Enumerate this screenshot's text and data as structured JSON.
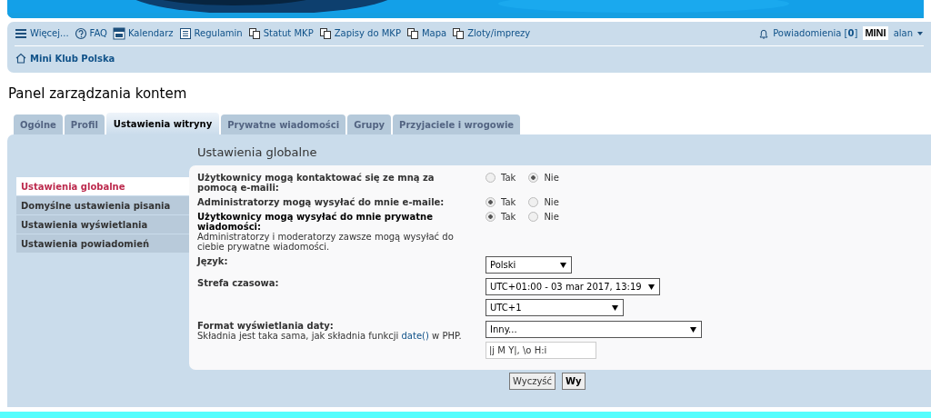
{
  "nav": {
    "items": [
      {
        "kind": "menu",
        "label": "Więcej..."
      },
      {
        "kind": "faq",
        "label": "FAQ"
      },
      {
        "kind": "calendar",
        "label": "Kalendarz"
      },
      {
        "kind": "rules",
        "label": "Regulamin"
      },
      {
        "kind": "page",
        "label": "Statut MKP"
      },
      {
        "kind": "page",
        "label": "Zapisy do MKP"
      },
      {
        "kind": "page",
        "label": "Mapa"
      },
      {
        "kind": "page",
        "label": "Zloty/imprezy"
      }
    ],
    "notifications": {
      "label": "Powiadomienia [**0**]"
    },
    "avatar_text": "MINI",
    "user": "alan",
    "breadcrumb": "Mini Klub Polska"
  },
  "page_title": "Panel zarządzania kontem",
  "tabs": [
    {
      "label": "Ogólne",
      "selected": false
    },
    {
      "label": "Profil",
      "selected": false
    },
    {
      "label": "Ustawienia witryny",
      "selected": true
    },
    {
      "label": "Prywatne wiadomości",
      "selected": false
    },
    {
      "label": "Grupy",
      "selected": false
    },
    {
      "label": "Przyjaciele i wrogowie",
      "selected": false
    }
  ],
  "sidebar": {
    "items": [
      {
        "label": "Ustawienia globalne",
        "selected": true
      },
      {
        "label": "Domyślne ustawienia pisania",
        "selected": false
      },
      {
        "label": "Ustawienia wyświetlania",
        "selected": false
      },
      {
        "label": "Ustawienia powiadomień",
        "selected": false
      }
    ]
  },
  "section_title": "Ustawienia globalne",
  "settings": [
    {
      "kind": "radio",
      "label": "Użytkownicy mogą kontaktować się ze mną za pomocą e-maili:",
      "options": [
        {
          "label": "Tak",
          "selected": false
        },
        {
          "label": "Nie",
          "selected": true
        }
      ]
    },
    {
      "kind": "radio",
      "label": "Administratorzy mogą wysyłać do mnie e-maile:",
      "options": [
        {
          "label": "Tak",
          "selected": true
        },
        {
          "label": "Nie",
          "selected": false
        }
      ]
    },
    {
      "kind": "radio",
      "label": "Użytkownicy mogą wysyłać do mnie prywatne wiadomości:",
      "hint": "Administratorzy i moderatorzy zawsze mogą wysyłać do ciebie prywatne wiadomości.",
      "options": [
        {
          "label": "Tak",
          "selected": true
        },
        {
          "label": "Nie",
          "selected": false
        }
      ]
    },
    {
      "kind": "select",
      "label": "Język:",
      "selects": [
        {
          "value": "Polski"
        }
      ]
    },
    {
      "kind": "select",
      "label": "Strefa czasowa:",
      "selects": [
        {
          "value": "UTC+01:00 - 03 mar 2017, 13:19"
        },
        {
          "value": "UTC+1"
        }
      ]
    },
    {
      "kind": "select",
      "label": "Format wyświetlania daty:",
      "hint_parts": {
        "before": "Składnia jest taka sama, jak składnia funkcji",
        "link": "date()",
        "after": "w PHP."
      },
      "selects": [
        {
          "value": "Inny..."
        }
      ],
      "input": "|j M Y|, \\o H:i"
    }
  ],
  "buttons": [
    {
      "kind": "reset",
      "label": "Wyczyść"
    },
    {
      "kind": "submit",
      "label": "Wy"
    }
  ]
}
